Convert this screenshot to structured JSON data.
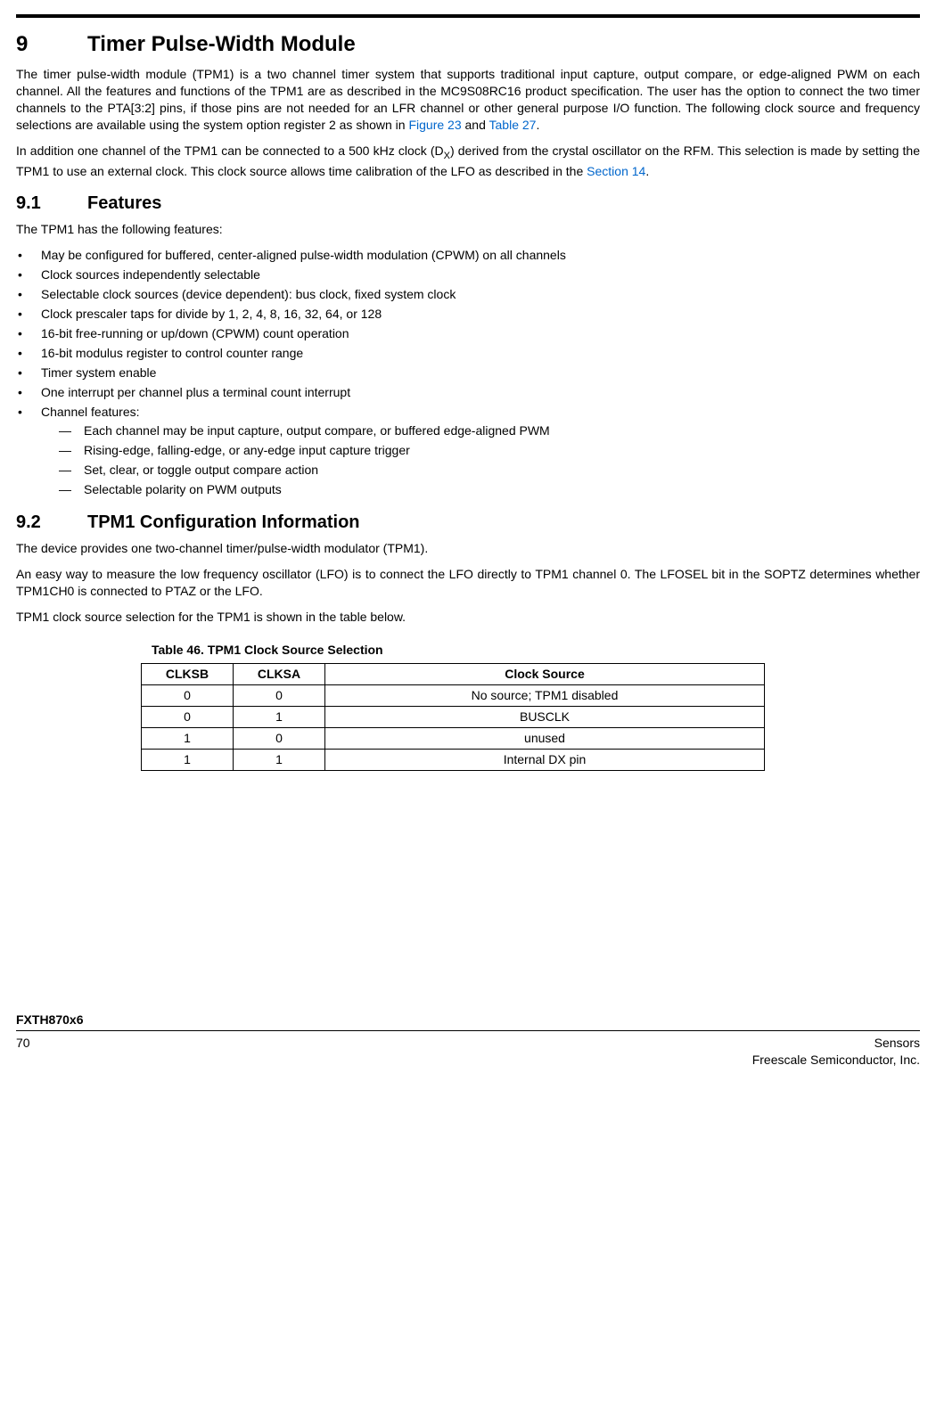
{
  "section9": {
    "num": "9",
    "title": "Timer Pulse-Width Module",
    "para1_a": "The timer pulse-width module (TPM1) is a two channel timer system that supports traditional input capture, output compare, or edge-aligned PWM on each channel. All the features and functions of the TPM1 are as described in the MC9S08RC16 product specification. The user has the option to connect the two timer channels to the PTA[3:2] pins, if those pins are not needed for an LFR channel or other general purpose I/O function. The following clock source and frequency selections are available using the system option register 2 as shown in ",
    "xref1": "Figure 23",
    "para1_mid": " and ",
    "xref2": "Table 27",
    "para1_end": ".",
    "para2_a": "In addition one channel of the TPM1 can be connected to a 500 kHz clock (D",
    "para2_sub": "X",
    "para2_b": ") derived from the crystal oscillator on the RFM. This selection is made by setting the TPM1 to use an external clock. This clock source allows time calibration of the LFO as described in the ",
    "xref3": "Section 14",
    "para2_end": "."
  },
  "section91": {
    "num": "9.1",
    "title": "Features",
    "intro": "The TPM1 has the following features:",
    "items": [
      "May be configured for buffered, center-aligned pulse-width modulation (CPWM) on all channels",
      "Clock sources independently selectable",
      "Selectable clock sources (device dependent): bus clock, fixed system clock",
      "Clock prescaler taps for divide by 1, 2, 4, 8, 16, 32, 64, or 128",
      "16-bit free-running or up/down (CPWM) count operation",
      "16-bit modulus register to control counter range",
      "Timer system enable",
      "One interrupt per channel plus a terminal count interrupt",
      "Channel features:"
    ],
    "subitems": [
      "Each channel may be input capture, output compare, or buffered edge-aligned PWM",
      "Rising-edge, falling-edge, or any-edge input capture trigger",
      "Set, clear, or toggle output compare action",
      "Selectable polarity on PWM outputs"
    ]
  },
  "section92": {
    "num": "9.2",
    "title": "TPM1 Configuration Information",
    "p1": "The device provides one two-channel timer/pulse-width modulator (TPM1).",
    "p2": "An easy way to measure the low frequency oscillator (LFO) is to connect the LFO directly to TPM1 channel 0. The LFOSEL bit in the SOPTZ determines whether TPM1CH0 is connected to PTAZ or the LFO.",
    "p3": "TPM1 clock source selection for the TPM1 is shown in the table below."
  },
  "table46": {
    "caption": "Table 46. TPM1 Clock Source Selection",
    "headers": [
      "CLKSB",
      "CLKSA",
      "Clock Source"
    ],
    "rows": [
      [
        "0",
        "0",
        "No source; TPM1 disabled"
      ],
      [
        "0",
        "1",
        "BUSCLK"
      ],
      [
        "1",
        "0",
        "unused"
      ],
      [
        "1",
        "1",
        "Internal DX pin"
      ]
    ]
  },
  "footer": {
    "docid": "FXTH870x6",
    "page": "70",
    "right1": "Sensors",
    "right2": "Freescale Semiconductor, Inc."
  }
}
